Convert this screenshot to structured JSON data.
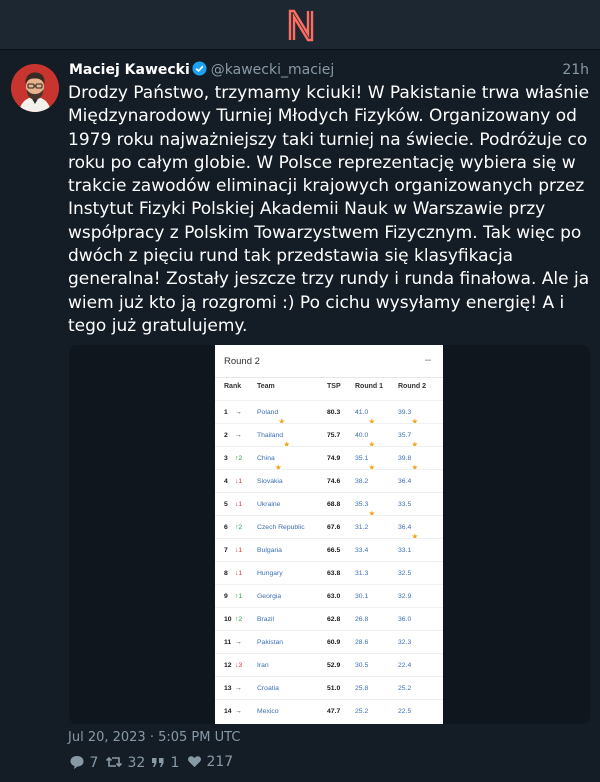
{
  "app": {
    "logo": "N"
  },
  "tweet": {
    "author_name": "Maciej Kawecki",
    "handle": "@kawecki_maciej",
    "time_ago": "21h",
    "text": "Drodzy Państwo, trzymamy kciuki! W Pakistanie trwa właśnie Międzynarodowy Turniej Młodych Fizyków. Organizowany od 1979 roku najważniejszy taki turniej na świecie. Podróżuje co roku po całym globie. W Polsce reprezentację wybiera się w trakcie zawodów eliminacji krajowych organizowanych przez Instytut Fizyki Polskiej Akademii Nauk w Warszawie przy współpracy z Polskim Towarzystwem Fizycznym. Tak więc po dwóch z pięciu rund tak przedstawia się klasyfikacja generalna! Zostały jeszcze trzy rundy i runda finałowa. Ale ja wiem już kto ją rozgromi :) Po cichu wysyłamy energię! A i tego już gratulujemy.",
    "date": "Jul 20, 2023 · 5:05 PM UTC",
    "stats": {
      "replies": "7",
      "retweets": "32",
      "quotes": "1",
      "likes": "217"
    }
  },
  "media": {
    "title": "Round 2",
    "collapse": "–",
    "columns": {
      "rank": "Rank",
      "team": "Team",
      "tsp": "TSP",
      "round1": "Round 1",
      "round2": "Round 2"
    },
    "rows": [
      {
        "rank": "1",
        "dir": "flat",
        "move": "",
        "team": "Poland",
        "team_star": true,
        "tsp": "80.3",
        "r1": "41.0",
        "r1_star": true,
        "r2": "39.3",
        "r2_star": true
      },
      {
        "rank": "2",
        "dir": "flat",
        "move": "",
        "team": "Thailand",
        "team_star": true,
        "tsp": "75.7",
        "r1": "40.0",
        "r1_star": true,
        "r2": "35.7",
        "r2_star": true
      },
      {
        "rank": "3",
        "dir": "up",
        "move": "2",
        "team": "China",
        "team_star": true,
        "tsp": "74.9",
        "r1": "35.1",
        "r1_star": true,
        "r2": "39.8",
        "r2_star": true
      },
      {
        "rank": "4",
        "dir": "down",
        "move": "1",
        "team": "Slovakia",
        "team_star": false,
        "tsp": "74.6",
        "r1": "38.2",
        "r1_star": false,
        "r2": "36.4",
        "r2_star": false
      },
      {
        "rank": "5",
        "dir": "down",
        "move": "1",
        "team": "Ukraine",
        "team_star": false,
        "tsp": "68.8",
        "r1": "35.3",
        "r1_star": true,
        "r2": "33.5",
        "r2_star": false
      },
      {
        "rank": "6",
        "dir": "up",
        "move": "2",
        "team": "Czech Republic",
        "team_star": false,
        "tsp": "67.6",
        "r1": "31.2",
        "r1_star": false,
        "r2": "36.4",
        "r2_star": true
      },
      {
        "rank": "7",
        "dir": "down",
        "move": "1",
        "team": "Bulgaria",
        "team_star": false,
        "tsp": "66.5",
        "r1": "33.4",
        "r1_star": false,
        "r2": "33.1",
        "r2_star": false
      },
      {
        "rank": "8",
        "dir": "down",
        "move": "1",
        "team": "Hungary",
        "team_star": false,
        "tsp": "63.8",
        "r1": "31.3",
        "r1_star": false,
        "r2": "32.5",
        "r2_star": false
      },
      {
        "rank": "9",
        "dir": "up",
        "move": "1",
        "team": "Georgia",
        "team_star": false,
        "tsp": "63.0",
        "r1": "30.1",
        "r1_star": false,
        "r2": "32.9",
        "r2_star": false
      },
      {
        "rank": "10",
        "dir": "up",
        "move": "2",
        "team": "Brazil",
        "team_star": false,
        "tsp": "62.8",
        "r1": "26.8",
        "r1_star": false,
        "r2": "36.0",
        "r2_star": false
      },
      {
        "rank": "11",
        "dir": "flat",
        "move": "",
        "team": "Pakistan",
        "team_star": false,
        "tsp": "60.9",
        "r1": "28.6",
        "r1_star": false,
        "r2": "32.3",
        "r2_star": false
      },
      {
        "rank": "12",
        "dir": "down",
        "move": "3",
        "team": "Iran",
        "team_star": false,
        "tsp": "52.9",
        "r1": "30.5",
        "r1_star": false,
        "r2": "22.4",
        "r2_star": false
      },
      {
        "rank": "13",
        "dir": "flat",
        "move": "",
        "team": "Croatia",
        "team_star": false,
        "tsp": "51.0",
        "r1": "25.8",
        "r1_star": false,
        "r2": "25.2",
        "r2_star": false
      },
      {
        "rank": "14",
        "dir": "flat",
        "move": "",
        "team": "Mexico",
        "team_star": false,
        "tsp": "47.7",
        "r1": "25.2",
        "r1_star": false,
        "r2": "22.5",
        "r2_star": false
      }
    ]
  },
  "icons": {
    "logo": "nitter-logo-icon",
    "verified": "verified-badge-icon",
    "reply": "comment-icon",
    "retweet": "retweet-icon",
    "quote": "quote-icon",
    "like": "heart-icon"
  },
  "colors": {
    "background": "#141d26",
    "header": "#1c2732",
    "logo": "#ff6c60",
    "muted": "#8899a6",
    "verified": "#1da1f2"
  }
}
